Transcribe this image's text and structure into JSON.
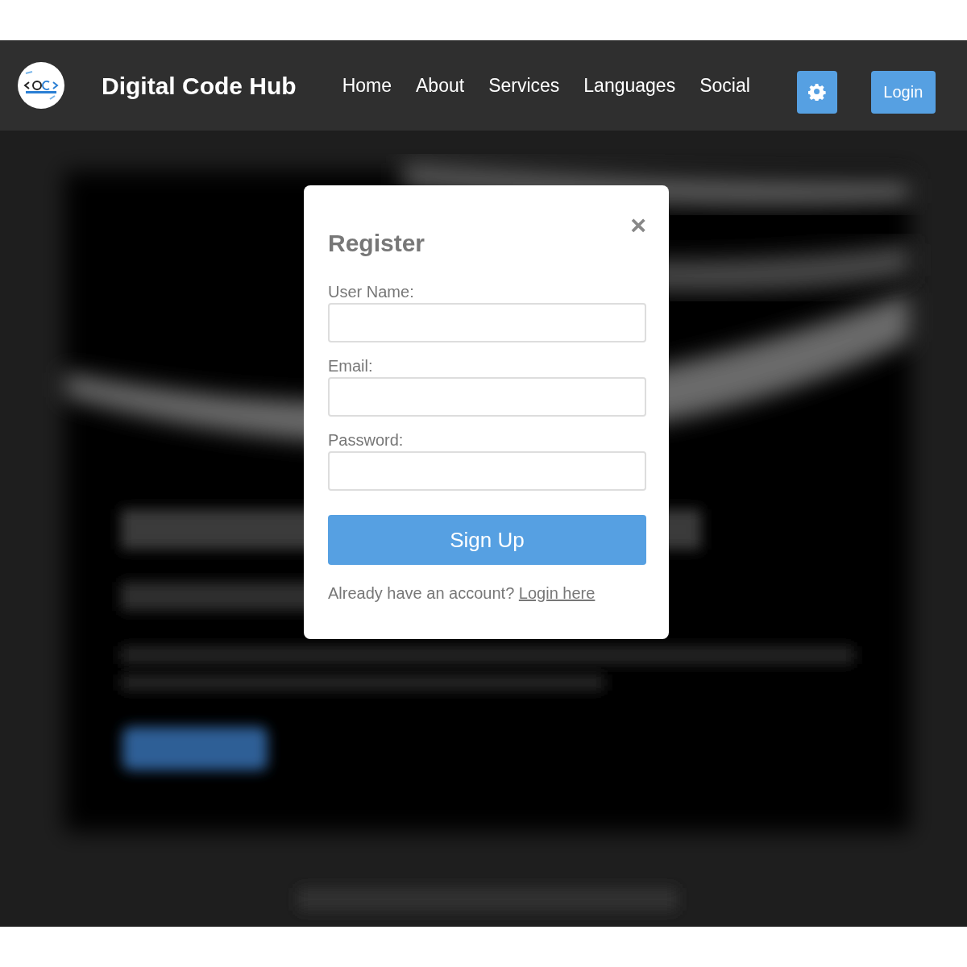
{
  "header": {
    "title": "Digital Code Hub",
    "nav": [
      "Home",
      "About",
      "Services",
      "Languages",
      "Social"
    ],
    "login_button": "Login"
  },
  "dialog": {
    "title": "Register",
    "close": "×",
    "fields": [
      {
        "label": "User Name:"
      },
      {
        "label": "Email:"
      },
      {
        "label": "Password:"
      }
    ],
    "submit": "Sign Up",
    "footer_text": "Already have an account?",
    "footer_link": "Login here"
  }
}
